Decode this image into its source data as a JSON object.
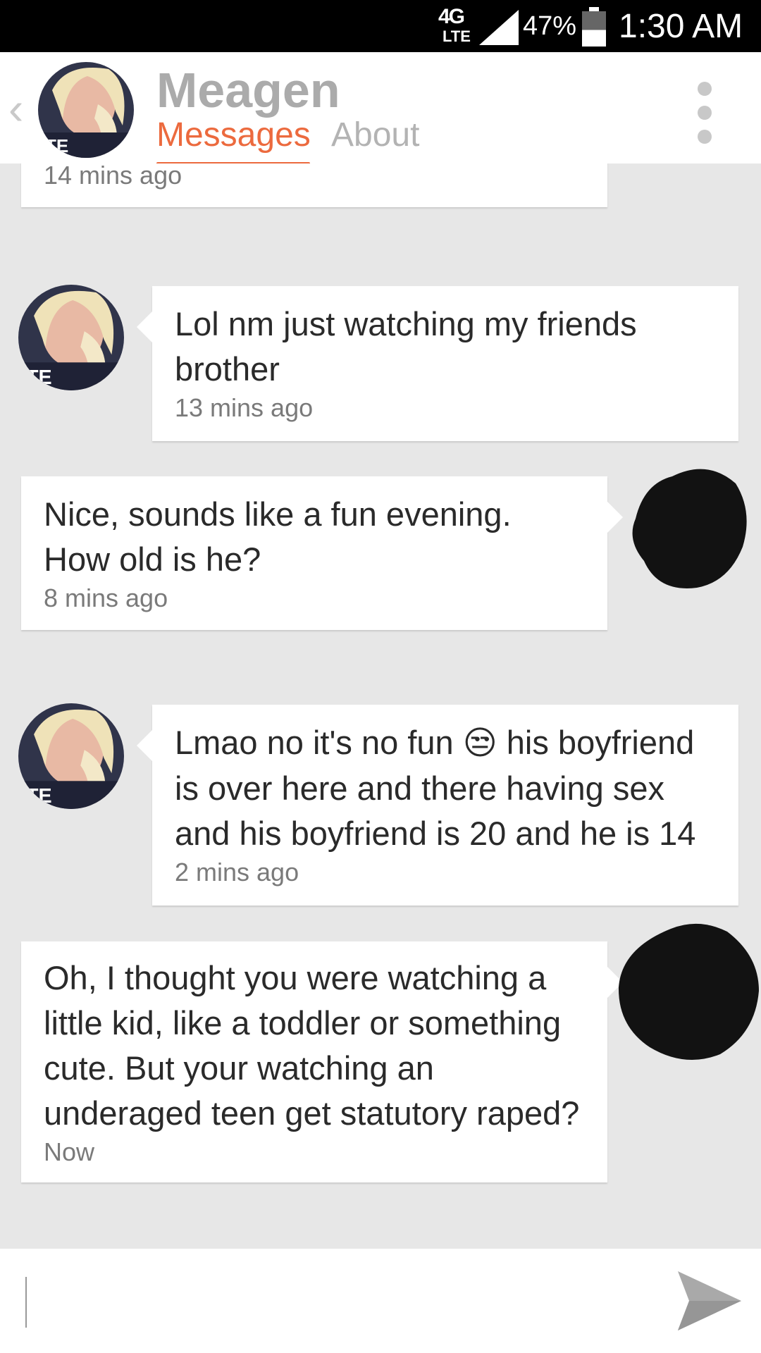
{
  "status_bar": {
    "network": "4G",
    "network_sub": "LTE",
    "battery_percent": "47%",
    "battery_level": 0.47,
    "time": "1:30 AM"
  },
  "header": {
    "back_icon": "chevron-left-icon",
    "contact_name": "Meagen",
    "tabs": [
      {
        "label": "Messages",
        "active": true
      },
      {
        "label": "About",
        "active": false
      }
    ],
    "menu_icon": "more-vertical-icon",
    "accent_color": "#ec6a3e"
  },
  "messages": [
    {
      "sender": "me",
      "text": "",
      "time": "14 mins ago"
    },
    {
      "sender": "them",
      "text": "Lol nm just watching my friends brother",
      "time": "13 mins ago"
    },
    {
      "sender": "me",
      "text": "Nice, sounds like a fun evening. How old is he?",
      "time": "8 mins ago"
    },
    {
      "sender": "them",
      "text_before_emoji": "Lmao no it's no fun",
      "emoji": "😒",
      "text_after_emoji": "his boyfriend is over here and there having sex and his boyfriend is 20 and he is 14",
      "time": "2 mins ago"
    },
    {
      "sender": "me",
      "text": "Oh, I thought you were watching a little kid, like a toddler or something cute. But your watching an underaged teen get statutory raped?",
      "time": "Now"
    }
  ],
  "composer": {
    "placeholder": "",
    "value": "",
    "send_icon": "send-icon"
  }
}
